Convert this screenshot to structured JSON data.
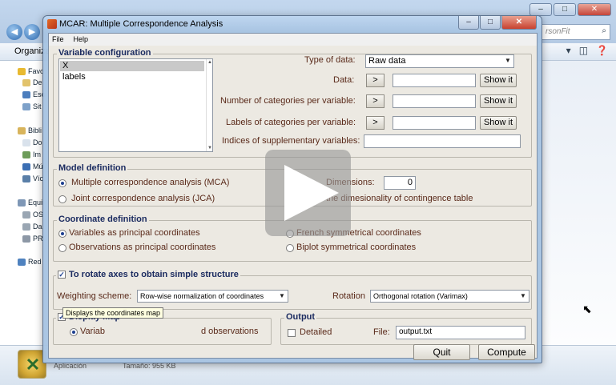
{
  "explorer": {
    "search_placeholder": "rsonFit",
    "organize_label": "Organiza",
    "sidebar": [
      {
        "label": "Favo",
        "icon": "star-icon"
      },
      {
        "label": "De",
        "icon": "folder-icon"
      },
      {
        "label": "Esc",
        "icon": "desktop-icon"
      },
      {
        "label": "Sit",
        "icon": "places-icon"
      },
      {
        "label": "Bibli",
        "icon": "library-icon"
      },
      {
        "label": "Do",
        "icon": "document-icon"
      },
      {
        "label": "Im",
        "icon": "image-icon"
      },
      {
        "label": "Mú",
        "icon": "music-icon"
      },
      {
        "label": "Víc",
        "icon": "video-icon"
      },
      {
        "label": "Equi",
        "icon": "computer-icon"
      },
      {
        "label": "OS",
        "icon": "drive-icon"
      },
      {
        "label": "Da",
        "icon": "drive-icon"
      },
      {
        "label": "PR",
        "icon": "network-drive-icon"
      },
      {
        "label": "Red",
        "icon": "network-icon"
      }
    ],
    "status": {
      "type": "Aplicación",
      "size": "Tamaño: 955 KB"
    }
  },
  "window": {
    "title": "MCAR: Multiple Correspondence Analysis",
    "menu": [
      "File",
      "Help"
    ]
  },
  "variable_configuration": {
    "legend": "Variable configuration",
    "list_items": [
      "X",
      "labels"
    ],
    "selected_index": 0,
    "type_of_data_label": "Type of data:",
    "type_of_data_value": "Raw data",
    "data_label": "Data:",
    "num_categories_label": "Number of categories per variable:",
    "labels_categories_label": "Labels of categories per variable:",
    "supplementary_label": "Indices of supplementary variables:",
    "arrow_label": ">",
    "show_it_label": "Show it"
  },
  "model_definition": {
    "legend": "Model definition",
    "mca_label": "Multiple correspondence analysis (MCA)",
    "jca_label": "Joint correspondence analysis (JCA)",
    "dimensions_label": "Dimensions:",
    "dimensions_value": "0",
    "dimensionality_label": "the dimesionality of contingence table"
  },
  "coordinate_definition": {
    "legend": "Coordinate definition",
    "variables_principal": "Variables as principal coordinates",
    "observations_principal": "Observations as principal coordinates",
    "french_symmetrical": "French symmetrical coordinates",
    "biplot_symmetrical": "Biplot symmetrical coordinates"
  },
  "rotation": {
    "legend": "To rotate axes to obtain simple structure",
    "weighting_label": "Weighting scheme:",
    "weighting_value": "Row-wise normalization of coordinates",
    "rotation_label": "Rotation",
    "rotation_value": "Orthogonal rotation (Varimax)"
  },
  "display_map": {
    "legend": "Display Map",
    "option_left": "Variab",
    "option_right": "d observations",
    "tooltip": "Displays the coordinates map"
  },
  "output": {
    "legend": "Output",
    "detailed_label": "Detailed",
    "file_label": "File:",
    "file_value": "output.txt"
  },
  "buttons": {
    "quit": "Quit",
    "compute": "Compute"
  },
  "colors": {
    "legend": "#1b2b60",
    "label": "#5a2a1a",
    "panel_bg": "#ece9e2"
  }
}
